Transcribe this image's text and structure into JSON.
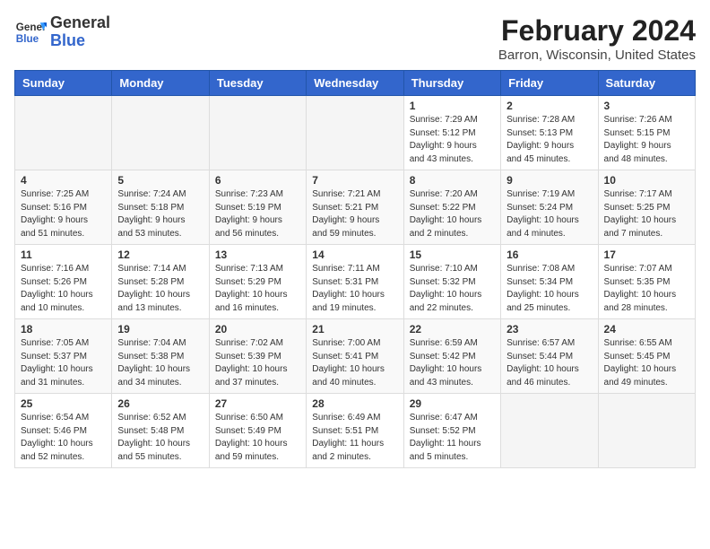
{
  "header": {
    "logo_line1": "General",
    "logo_line2": "Blue",
    "title": "February 2024",
    "subtitle": "Barron, Wisconsin, United States"
  },
  "weekdays": [
    "Sunday",
    "Monday",
    "Tuesday",
    "Wednesday",
    "Thursday",
    "Friday",
    "Saturday"
  ],
  "weeks": [
    [
      {
        "day": "",
        "info": ""
      },
      {
        "day": "",
        "info": ""
      },
      {
        "day": "",
        "info": ""
      },
      {
        "day": "",
        "info": ""
      },
      {
        "day": "1",
        "info": "Sunrise: 7:29 AM\nSunset: 5:12 PM\nDaylight: 9 hours\nand 43 minutes."
      },
      {
        "day": "2",
        "info": "Sunrise: 7:28 AM\nSunset: 5:13 PM\nDaylight: 9 hours\nand 45 minutes."
      },
      {
        "day": "3",
        "info": "Sunrise: 7:26 AM\nSunset: 5:15 PM\nDaylight: 9 hours\nand 48 minutes."
      }
    ],
    [
      {
        "day": "4",
        "info": "Sunrise: 7:25 AM\nSunset: 5:16 PM\nDaylight: 9 hours\nand 51 minutes."
      },
      {
        "day": "5",
        "info": "Sunrise: 7:24 AM\nSunset: 5:18 PM\nDaylight: 9 hours\nand 53 minutes."
      },
      {
        "day": "6",
        "info": "Sunrise: 7:23 AM\nSunset: 5:19 PM\nDaylight: 9 hours\nand 56 minutes."
      },
      {
        "day": "7",
        "info": "Sunrise: 7:21 AM\nSunset: 5:21 PM\nDaylight: 9 hours\nand 59 minutes."
      },
      {
        "day": "8",
        "info": "Sunrise: 7:20 AM\nSunset: 5:22 PM\nDaylight: 10 hours\nand 2 minutes."
      },
      {
        "day": "9",
        "info": "Sunrise: 7:19 AM\nSunset: 5:24 PM\nDaylight: 10 hours\nand 4 minutes."
      },
      {
        "day": "10",
        "info": "Sunrise: 7:17 AM\nSunset: 5:25 PM\nDaylight: 10 hours\nand 7 minutes."
      }
    ],
    [
      {
        "day": "11",
        "info": "Sunrise: 7:16 AM\nSunset: 5:26 PM\nDaylight: 10 hours\nand 10 minutes."
      },
      {
        "day": "12",
        "info": "Sunrise: 7:14 AM\nSunset: 5:28 PM\nDaylight: 10 hours\nand 13 minutes."
      },
      {
        "day": "13",
        "info": "Sunrise: 7:13 AM\nSunset: 5:29 PM\nDaylight: 10 hours\nand 16 minutes."
      },
      {
        "day": "14",
        "info": "Sunrise: 7:11 AM\nSunset: 5:31 PM\nDaylight: 10 hours\nand 19 minutes."
      },
      {
        "day": "15",
        "info": "Sunrise: 7:10 AM\nSunset: 5:32 PM\nDaylight: 10 hours\nand 22 minutes."
      },
      {
        "day": "16",
        "info": "Sunrise: 7:08 AM\nSunset: 5:34 PM\nDaylight: 10 hours\nand 25 minutes."
      },
      {
        "day": "17",
        "info": "Sunrise: 7:07 AM\nSunset: 5:35 PM\nDaylight: 10 hours\nand 28 minutes."
      }
    ],
    [
      {
        "day": "18",
        "info": "Sunrise: 7:05 AM\nSunset: 5:37 PM\nDaylight: 10 hours\nand 31 minutes."
      },
      {
        "day": "19",
        "info": "Sunrise: 7:04 AM\nSunset: 5:38 PM\nDaylight: 10 hours\nand 34 minutes."
      },
      {
        "day": "20",
        "info": "Sunrise: 7:02 AM\nSunset: 5:39 PM\nDaylight: 10 hours\nand 37 minutes."
      },
      {
        "day": "21",
        "info": "Sunrise: 7:00 AM\nSunset: 5:41 PM\nDaylight: 10 hours\nand 40 minutes."
      },
      {
        "day": "22",
        "info": "Sunrise: 6:59 AM\nSunset: 5:42 PM\nDaylight: 10 hours\nand 43 minutes."
      },
      {
        "day": "23",
        "info": "Sunrise: 6:57 AM\nSunset: 5:44 PM\nDaylight: 10 hours\nand 46 minutes."
      },
      {
        "day": "24",
        "info": "Sunrise: 6:55 AM\nSunset: 5:45 PM\nDaylight: 10 hours\nand 49 minutes."
      }
    ],
    [
      {
        "day": "25",
        "info": "Sunrise: 6:54 AM\nSunset: 5:46 PM\nDaylight: 10 hours\nand 52 minutes."
      },
      {
        "day": "26",
        "info": "Sunrise: 6:52 AM\nSunset: 5:48 PM\nDaylight: 10 hours\nand 55 minutes."
      },
      {
        "day": "27",
        "info": "Sunrise: 6:50 AM\nSunset: 5:49 PM\nDaylight: 10 hours\nand 59 minutes."
      },
      {
        "day": "28",
        "info": "Sunrise: 6:49 AM\nSunset: 5:51 PM\nDaylight: 11 hours\nand 2 minutes."
      },
      {
        "day": "29",
        "info": "Sunrise: 6:47 AM\nSunset: 5:52 PM\nDaylight: 11 hours\nand 5 minutes."
      },
      {
        "day": "",
        "info": ""
      },
      {
        "day": "",
        "info": ""
      }
    ]
  ]
}
